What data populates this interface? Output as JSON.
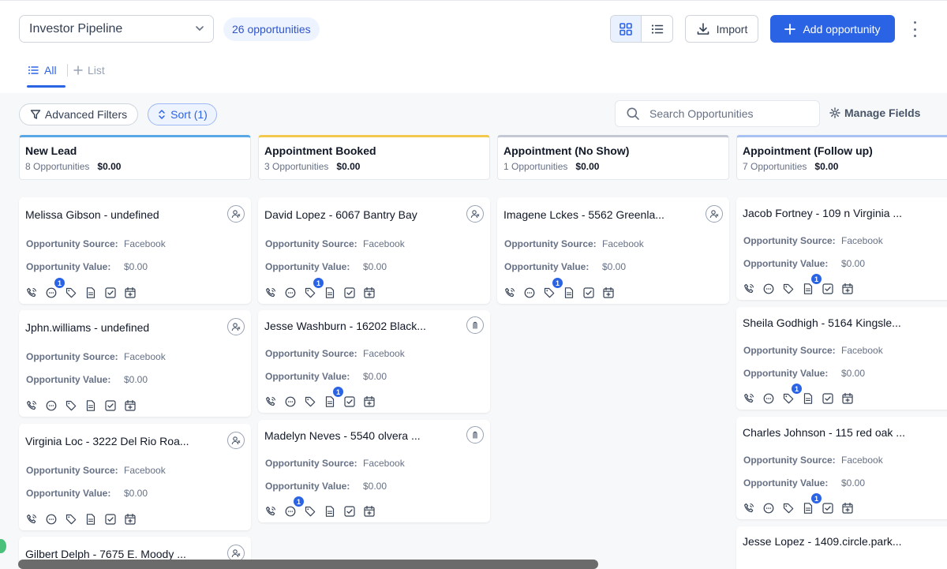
{
  "header": {
    "pipeline_name": "Investor Pipeline",
    "opportunity_count": "26 opportunities",
    "import_label": "Import",
    "add_label": "Add opportunity"
  },
  "tabs": {
    "all_label": "All",
    "list_label": "List"
  },
  "toolbar": {
    "filters_label": "Advanced Filters",
    "sort_label": "Sort (1)",
    "search_placeholder": "Search Opportunities",
    "manage_fields_label": "Manage Fields"
  },
  "field_labels": {
    "source": "Opportunity Source:",
    "value": "Opportunity Value:"
  },
  "colors": {
    "accent": "#2b63e5",
    "badge_bg": "#eef4ff"
  },
  "columns": [
    {
      "title": "New Lead",
      "count": "8 Opportunities",
      "amount": "$0.00",
      "accent": "#5aa7e6",
      "cards": [
        {
          "title": "Melissa Gibson - undefined",
          "source": "Facebook",
          "value": "$0.00",
          "owner_icon": "unassigned-user-icon",
          "badge_icon": "message",
          "badge": "1"
        },
        {
          "title": "Jphn.williams - undefined",
          "source": "Facebook",
          "value": "$0.00",
          "owner_icon": "unassigned-user-icon",
          "badge_icon": "",
          "badge": ""
        },
        {
          "title": "Virginia Loc - 3222 Del Rio Roa...",
          "source": "Facebook",
          "value": "$0.00",
          "owner_icon": "unassigned-user-icon",
          "badge_icon": "",
          "badge": ""
        },
        {
          "title": "Gilbert Delph - 7675 E. Moody ...",
          "source": "",
          "value": "",
          "owner_icon": "unassigned-user-icon",
          "badge_icon": "",
          "badge": ""
        }
      ]
    },
    {
      "title": "Appointment Booked",
      "count": "3 Opportunities",
      "amount": "$0.00",
      "accent": "#f2c94c",
      "cards": [
        {
          "title": "David Lopez - 6067 Bantry Bay",
          "source": "Facebook",
          "value": "$0.00",
          "owner_icon": "unassigned-user-icon",
          "badge_icon": "tag",
          "badge": "1"
        },
        {
          "title": "Jesse Washburn - 16202 Black...",
          "source": "Facebook",
          "value": "$0.00",
          "owner_icon": "avatar-icon",
          "badge_icon": "note",
          "badge": "1"
        },
        {
          "title": "Madelyn Neves - 5540 olvera ...",
          "source": "Facebook",
          "value": "$0.00",
          "owner_icon": "avatar-icon",
          "badge_icon": "message",
          "badge": "1"
        }
      ]
    },
    {
      "title": "Appointment (No Show)",
      "count": "1 Opportunities",
      "amount": "$0.00",
      "accent": "#c3c8d4",
      "cards": [
        {
          "title": "Imagene Lckes - 5562 Greenla...",
          "source": "Facebook",
          "value": "$0.00",
          "owner_icon": "unassigned-user-icon",
          "badge_icon": "tag",
          "badge": "1"
        }
      ]
    },
    {
      "title": "Appointment (Follow up)",
      "count": "7 Opportunities",
      "amount": "$0.00",
      "accent": "#a9c1f2",
      "cards": [
        {
          "title": "Jacob Fortney - 109 n Virginia ...",
          "source": "Facebook",
          "value": "$0.00",
          "owner_icon": "",
          "badge_icon": "note",
          "badge": "1"
        },
        {
          "title": "Sheila Godhigh - 5164 Kingsle...",
          "source": "Facebook",
          "value": "$0.00",
          "owner_icon": "",
          "badge_icon": "tag",
          "badge": "1"
        },
        {
          "title": "Charles Johnson - 115 red oak ...",
          "source": "Facebook",
          "value": "$0.00",
          "owner_icon": "",
          "badge_icon": "note",
          "badge": "1"
        },
        {
          "title": "Jesse Lopez - 1409.circle.park...",
          "source": "",
          "value": "",
          "owner_icon": "",
          "badge_icon": "",
          "badge": ""
        }
      ]
    }
  ]
}
